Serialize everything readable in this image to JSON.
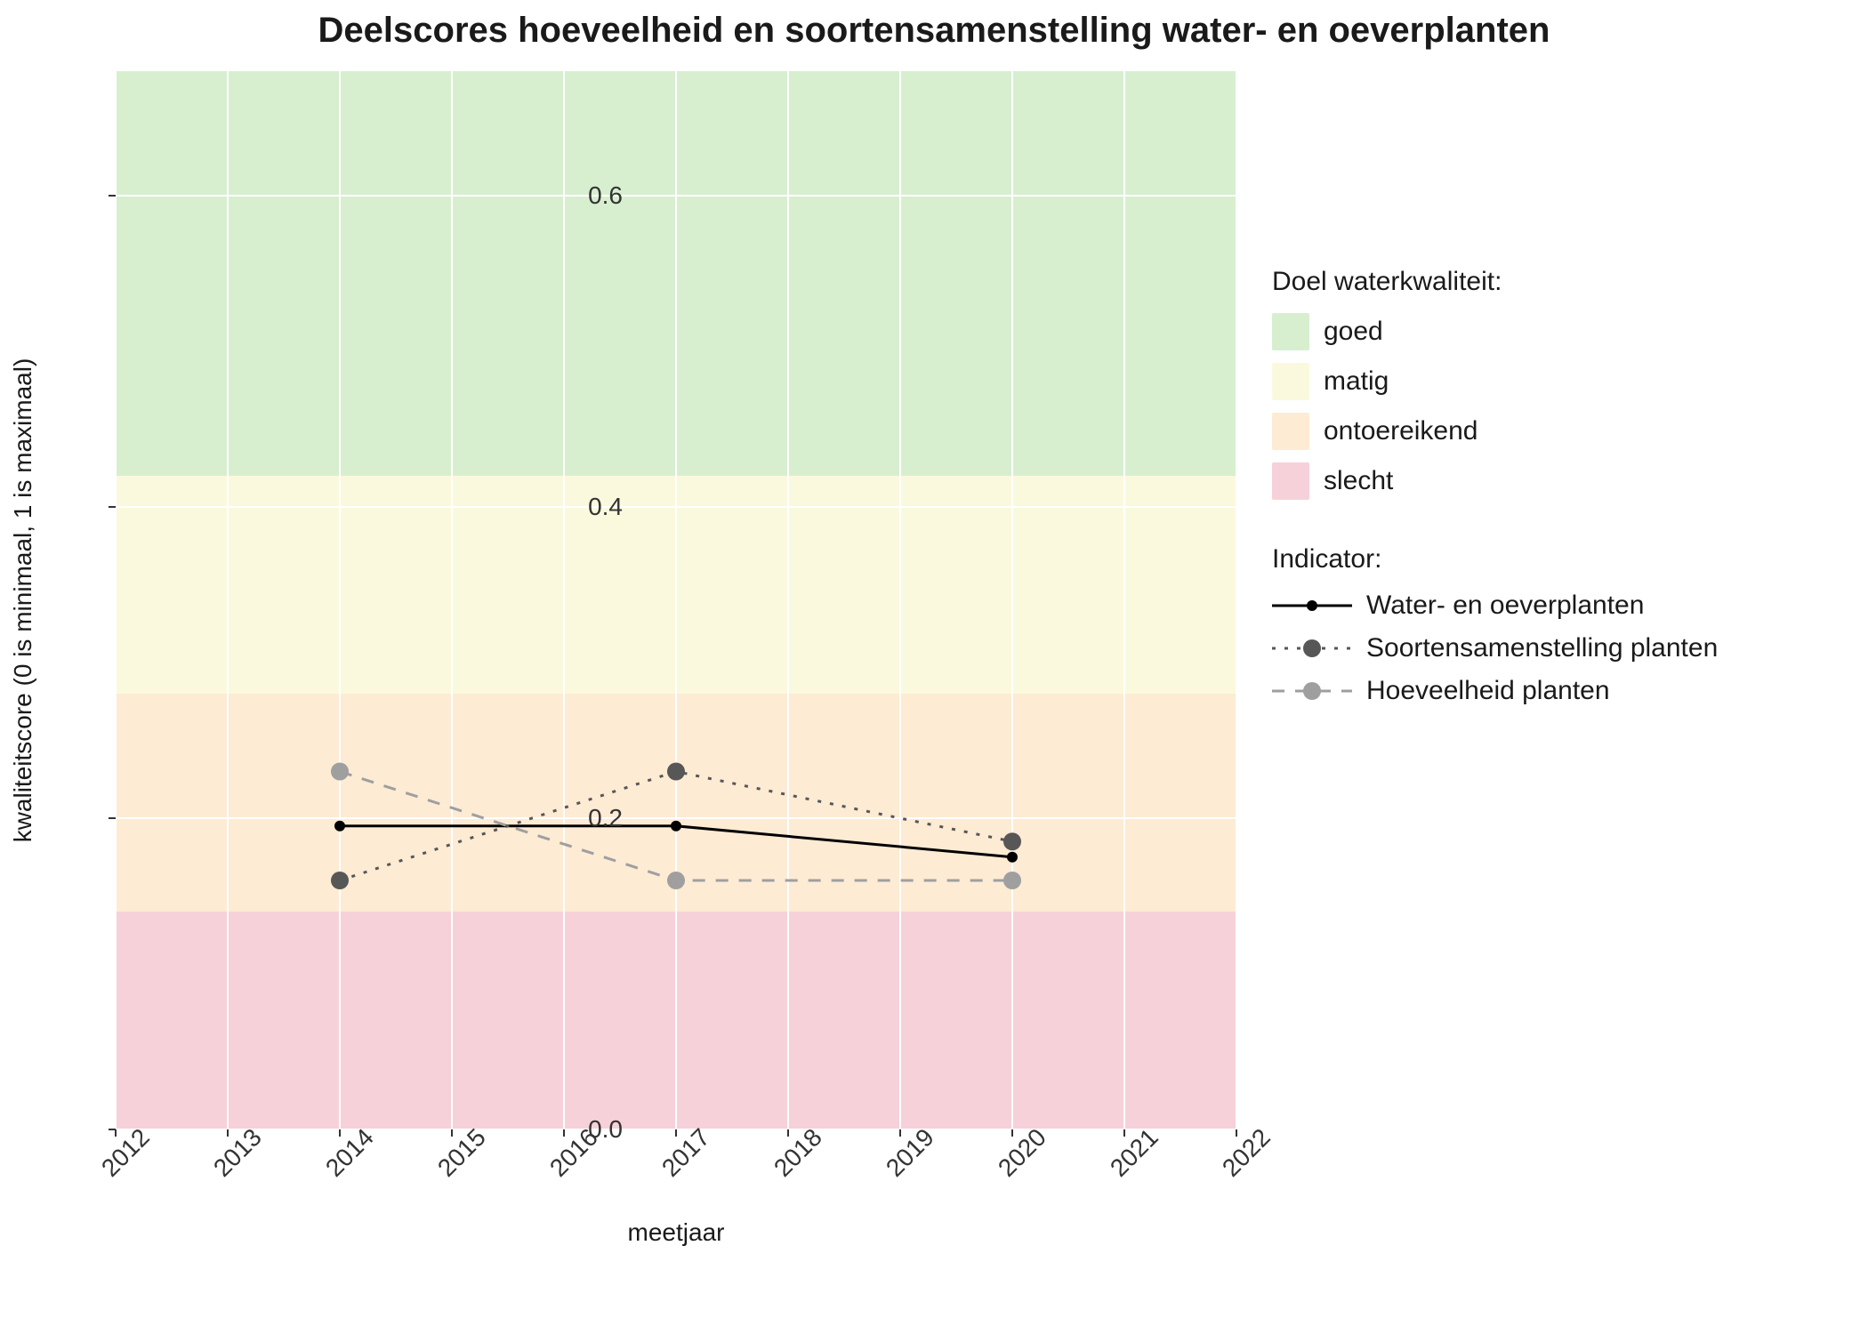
{
  "chart_data": {
    "type": "line",
    "title": "Deelscores hoeveelheid en soortensamenstelling water- en oeverplanten",
    "xlabel": "meetjaar",
    "ylabel": "kwaliteitscore (0 is minimaal, 1 is maximaal)",
    "x_ticks": [
      2012,
      2013,
      2014,
      2015,
      2016,
      2017,
      2018,
      2019,
      2020,
      2021,
      2022
    ],
    "y_ticks": [
      0.0,
      0.2,
      0.4,
      0.6
    ],
    "xlim": [
      2012,
      2022
    ],
    "ylim": [
      0.0,
      0.68
    ],
    "grid": true,
    "x": [
      2014,
      2017,
      2020
    ],
    "series": [
      {
        "name": "Water- en oeverplanten",
        "values": [
          0.195,
          0.195,
          0.175
        ],
        "color": "#000000",
        "dash": "solid",
        "marker_size": 6
      },
      {
        "name": "Soortensamenstelling planten",
        "values": [
          0.16,
          0.23,
          0.185
        ],
        "color": "#575757",
        "dash": "dotted",
        "marker_size": 10
      },
      {
        "name": "Hoeveelheid planten",
        "values": [
          0.23,
          0.16,
          0.16
        ],
        "color": "#9f9f9f",
        "dash": "dashed",
        "marker_size": 10
      }
    ],
    "bands_title": "Doel waterkwaliteit:",
    "bands": [
      {
        "label": "goed",
        "color": "#d7efcf",
        "from": 0.42,
        "to": 0.68
      },
      {
        "label": "matig",
        "color": "#fbf9dd",
        "from": 0.28,
        "to": 0.42
      },
      {
        "label": "ontoereikend",
        "color": "#fdebd4",
        "from": 0.14,
        "to": 0.28
      },
      {
        "label": "slecht",
        "color": "#f7d1d9",
        "from": 0.0,
        "to": 0.14
      }
    ],
    "indicator_title": "Indicator:"
  }
}
